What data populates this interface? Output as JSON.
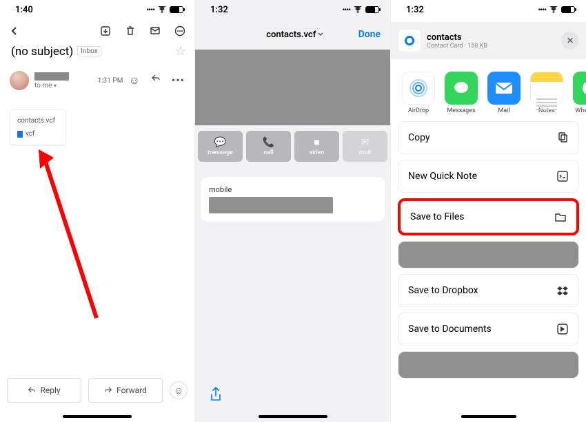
{
  "screen1": {
    "status": {
      "time": "1:40"
    },
    "subject": "(no subject)",
    "inboxTag": "Inbox",
    "message": {
      "time": "1:31 PM",
      "toLine": "to me",
      "senderRedacted": true
    },
    "attachment": {
      "name": "contacts.vcf",
      "ext": "vcf"
    },
    "reply": "Reply",
    "forward": "Forward"
  },
  "screen2": {
    "status": {
      "time": "1:32"
    },
    "nav": {
      "title": "contacts.vcf",
      "done": "Done"
    },
    "actions": {
      "message": "message",
      "call": "call",
      "video": "video",
      "mail": "mail"
    },
    "info": {
      "mobileLabel": "mobile"
    }
  },
  "screen3": {
    "status": {
      "time": "1:32"
    },
    "file": {
      "title": "contacts",
      "subtitle": "Contact Card · 158 KB"
    },
    "icons": {
      "airdrop": "AirDrop",
      "messages": "Messages",
      "mail": "Mail",
      "notes": "Notes",
      "wa": "WhatsApp"
    },
    "actions": {
      "copy": "Copy",
      "newQuickNote": "New Quick Note",
      "saveToFiles": "Save to Files",
      "saveDropbox": "Save to Dropbox",
      "saveDocuments": "Save to Documents"
    }
  }
}
